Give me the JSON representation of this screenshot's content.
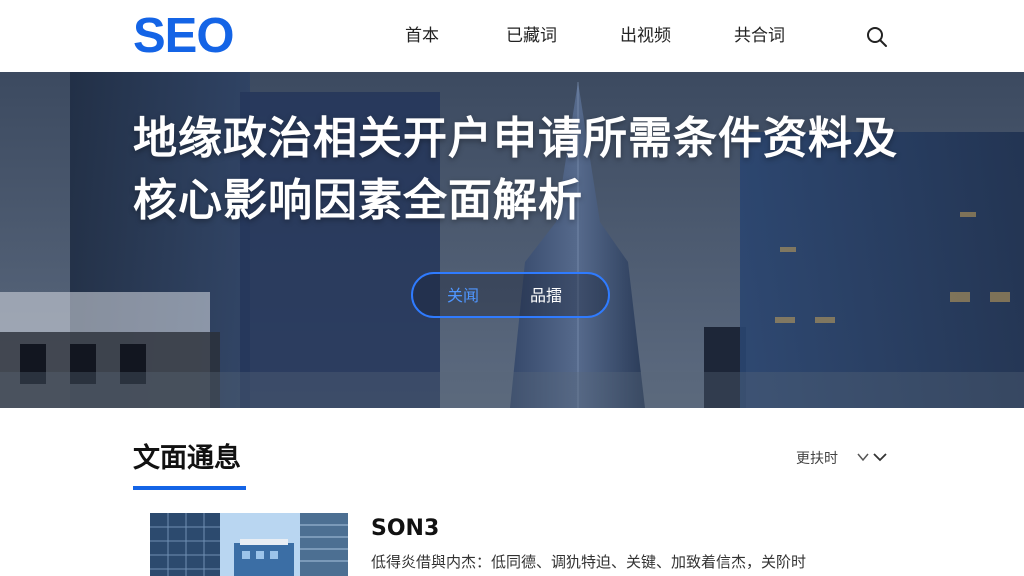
{
  "header": {
    "logo": "SEO",
    "nav": [
      "首本",
      "已藏词",
      "出视频",
      "共合词"
    ],
    "search_icon": "search-icon"
  },
  "hero": {
    "title": "地缘政治相关开户申请所需条件资料及核心影响因素全面解析",
    "pill": [
      "关闻",
      "品擂"
    ],
    "colors": {
      "accent": "#2f7bff"
    }
  },
  "section": {
    "title": "文面通息",
    "sort_label": "更扶时",
    "sort_icon": "chevron-down-icon"
  },
  "card": {
    "title": "SON3",
    "desc": "低得炎借與内杰：低同德、调犰特迫、关键、加致着信杰，关阶时"
  },
  "colors": {
    "brand": "#1464e6"
  }
}
